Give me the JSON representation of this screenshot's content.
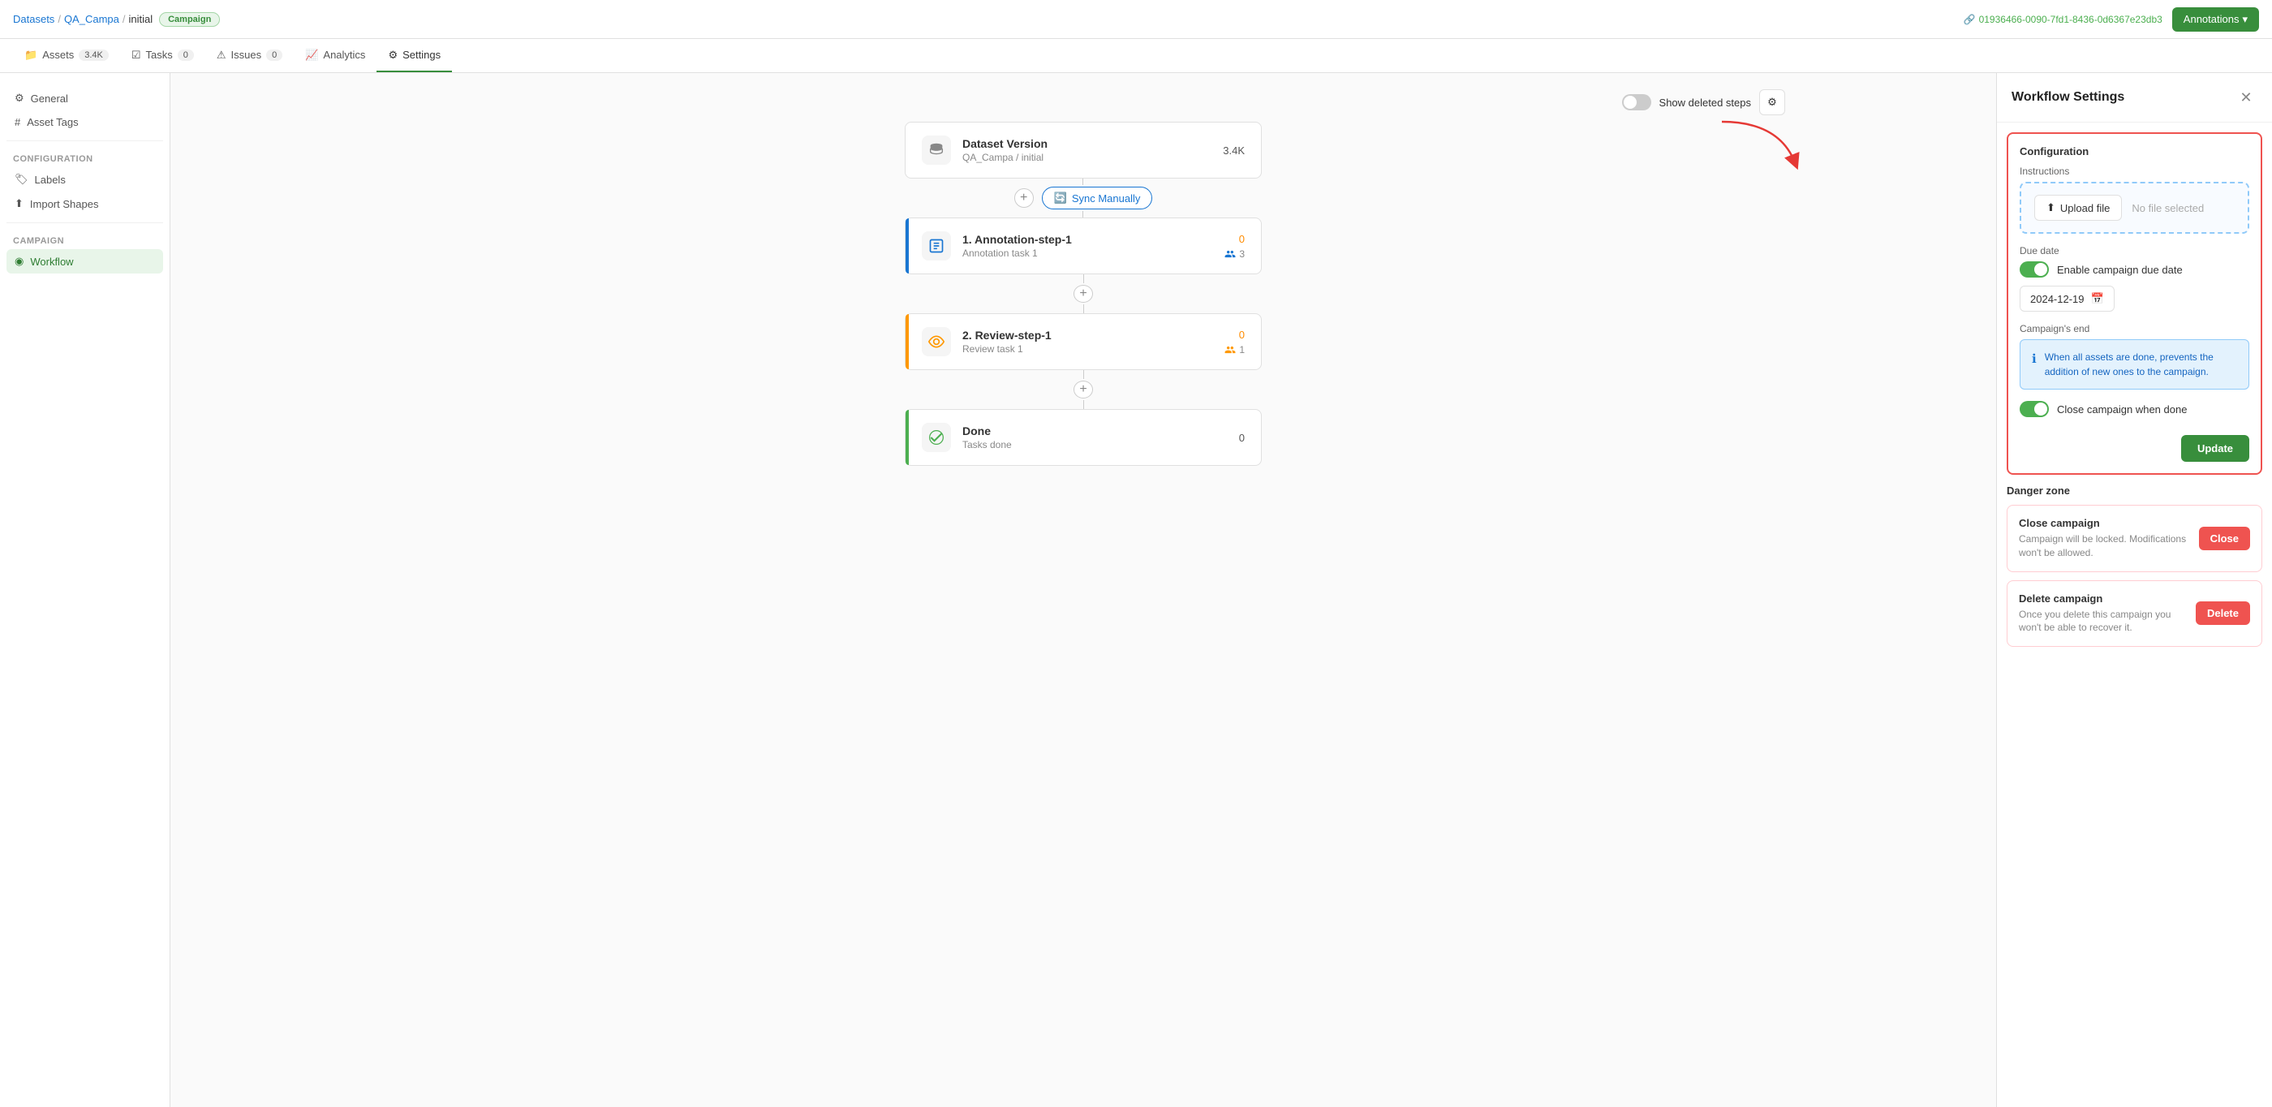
{
  "topbar": {
    "breadcrumbs": [
      "Datasets",
      "QA_Campa",
      "initial"
    ],
    "badge": "Campaign",
    "uuid": "01936466-0090-7fd1-8436-0d6367e23db3",
    "annotations_btn": "Annotations"
  },
  "navtabs": [
    {
      "id": "assets",
      "label": "Assets",
      "count": "3.4K"
    },
    {
      "id": "tasks",
      "label": "Tasks",
      "count": "0"
    },
    {
      "id": "issues",
      "label": "Issues",
      "count": "0"
    },
    {
      "id": "analytics",
      "label": "Analytics",
      "count": ""
    },
    {
      "id": "settings",
      "label": "Settings",
      "count": ""
    }
  ],
  "sidebar": {
    "items": [
      {
        "id": "general",
        "label": "General",
        "icon": "⚙"
      },
      {
        "id": "asset-tags",
        "label": "Asset Tags",
        "icon": "#"
      }
    ],
    "config_label": "Configuration",
    "config_items": [
      {
        "id": "labels",
        "label": "Labels",
        "icon": "🏷"
      },
      {
        "id": "import-shapes",
        "label": "Import Shapes",
        "icon": "⬆"
      }
    ],
    "campaign_label": "Campaign",
    "campaign_items": [
      {
        "id": "workflow",
        "label": "Workflow",
        "icon": "◉",
        "active": true
      }
    ]
  },
  "workflow": {
    "show_deleted_label": "Show deleted steps",
    "sync_btn": "Sync Manually",
    "nodes": [
      {
        "id": "dataset-version",
        "title": "Dataset Version",
        "sub": "QA_Campa / initial",
        "count": "3.4K",
        "icon": "dataset",
        "border": ""
      },
      {
        "id": "annotation-step-1",
        "title": "1. Annotation-step-1",
        "sub": "Annotation task 1",
        "count_top": "0",
        "count_bottom": "3",
        "icon": "edit",
        "border": "blue"
      },
      {
        "id": "review-step-1",
        "title": "2. Review-step-1",
        "sub": "Review task 1",
        "count_top": "0",
        "count_bottom": "1",
        "icon": "eye",
        "border": "orange"
      },
      {
        "id": "done",
        "title": "Done",
        "sub": "Tasks done",
        "count": "0",
        "icon": "check",
        "border": "green"
      }
    ]
  },
  "panel": {
    "title": "Workflow Settings",
    "config_label": "Configuration",
    "instructions_label": "Instructions",
    "upload_btn": "Upload file",
    "no_file": "No file selected",
    "due_date_label": "Due date",
    "enable_due_date_label": "Enable campaign due date",
    "date_value": "2024-12-19",
    "campaigns_end_label": "Campaign's end",
    "info_text": "When all assets are done, prevents the addition of new ones to the campaign.",
    "close_campaign_when_done_label": "Close campaign when done",
    "update_btn": "Update",
    "danger_zone_label": "Danger zone",
    "close_campaign_title": "Close campaign",
    "close_campaign_desc": "Campaign will be locked. Modifications won't be allowed.",
    "close_btn": "Close",
    "delete_campaign_title": "Delete campaign",
    "delete_campaign_desc": "Once you delete this campaign you won't be able to recover it.",
    "delete_btn": "Delete"
  }
}
